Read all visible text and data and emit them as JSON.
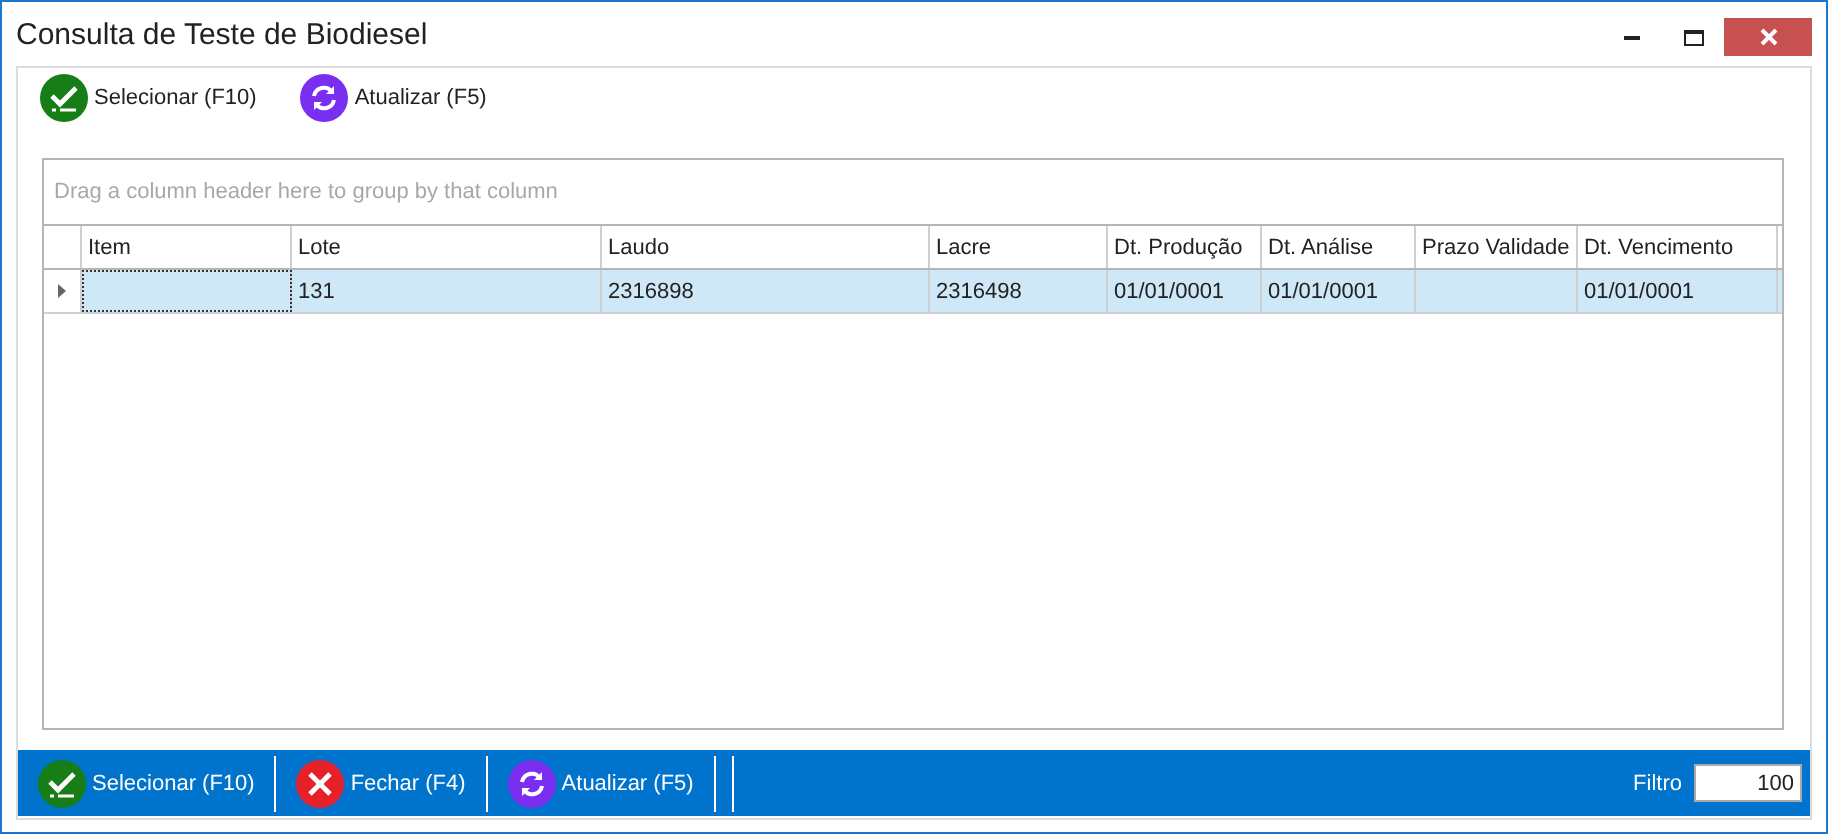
{
  "window": {
    "title": "Consulta de Teste de Biodiesel"
  },
  "toolbar": [
    {
      "kind": "select",
      "label": "Selecionar (F10)"
    },
    {
      "kind": "refresh",
      "label": "Atualizar (F5)"
    }
  ],
  "grid": {
    "group_panel": "Drag a column header here to group by that column",
    "columns": [
      "Item",
      "Lote",
      "Laudo",
      "Lacre",
      "Dt. Produção",
      "Dt. Análise",
      "Prazo Validade",
      "Dt. Vencimento"
    ],
    "rows": [
      {
        "selected": true,
        "cells": [
          null,
          "131",
          "2316898",
          "2316498",
          "01/01/0001",
          "01/01/0001",
          null,
          "01/01/0001"
        ]
      }
    ]
  },
  "bottom_bar": {
    "buttons": [
      {
        "kind": "select",
        "label": "Selecionar (F10)"
      },
      {
        "kind": "close",
        "label": "Fechar (F4)"
      },
      {
        "kind": "refresh",
        "label": "Atualizar (F5)"
      }
    ],
    "filter": {
      "label": "Filtro",
      "value": "100"
    }
  }
}
